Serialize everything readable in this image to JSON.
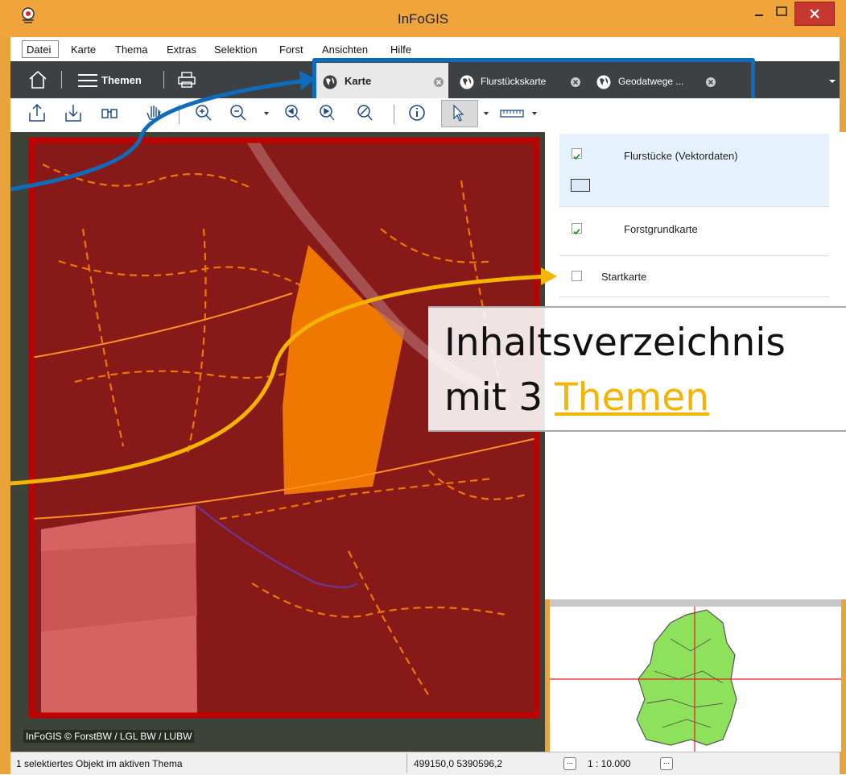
{
  "window": {
    "title": "InFoGIS",
    "colors": {
      "frame": "#f0a43b",
      "close": "#c7372f"
    }
  },
  "menu": {
    "items": [
      "Datei",
      "Karte",
      "Thema",
      "Extras",
      "Selektion",
      "Forst",
      "Ansichten",
      "Hilfe"
    ]
  },
  "toolbar": {
    "themes_label": "Themen",
    "tabs": [
      {
        "label": "Karte",
        "active": true,
        "icon": "globe-icon"
      },
      {
        "label": "Flurstückskarte",
        "active": false,
        "icon": "globe-icon"
      },
      {
        "label": "Geodatwege ...",
        "active": false,
        "icon": "globe-icon"
      }
    ],
    "icons": [
      "export-icon",
      "import-icon",
      "binoculars-icon",
      "hand-pan-icon",
      "zoom-in-icon",
      "zoom-out-icon",
      "zoom-previous-icon",
      "zoom-next-icon",
      "zoom-extent-icon",
      "info-icon",
      "select-arrow-icon",
      "scale-ruler-icon"
    ]
  },
  "map": {
    "credit": "InFoGIS © ForstBW / LGL BW / LUBW",
    "colors": {
      "selection_frame": "#c00000",
      "highlight_parcel": "#f07800",
      "tab_frame": "#0f6cbd",
      "arrow": "#f5b400"
    }
  },
  "legend": {
    "layers": [
      {
        "label": "Flurstücke (Vektordaten)",
        "checked": true
      },
      {
        "label": "Forstgrundkarte",
        "checked": true
      },
      {
        "label": "Startkarte",
        "checked": false
      }
    ]
  },
  "callout": {
    "line1": "Inhaltsverzeichnis",
    "line2_prefix": "mit 3",
    "line2_highlight": "Themen"
  },
  "status": {
    "selection": "1 selektiertes Objekt im aktiven Thema",
    "coordinates": "499150,0  5390596,2",
    "scale": "1 : 10.000",
    "more_button": "..."
  }
}
